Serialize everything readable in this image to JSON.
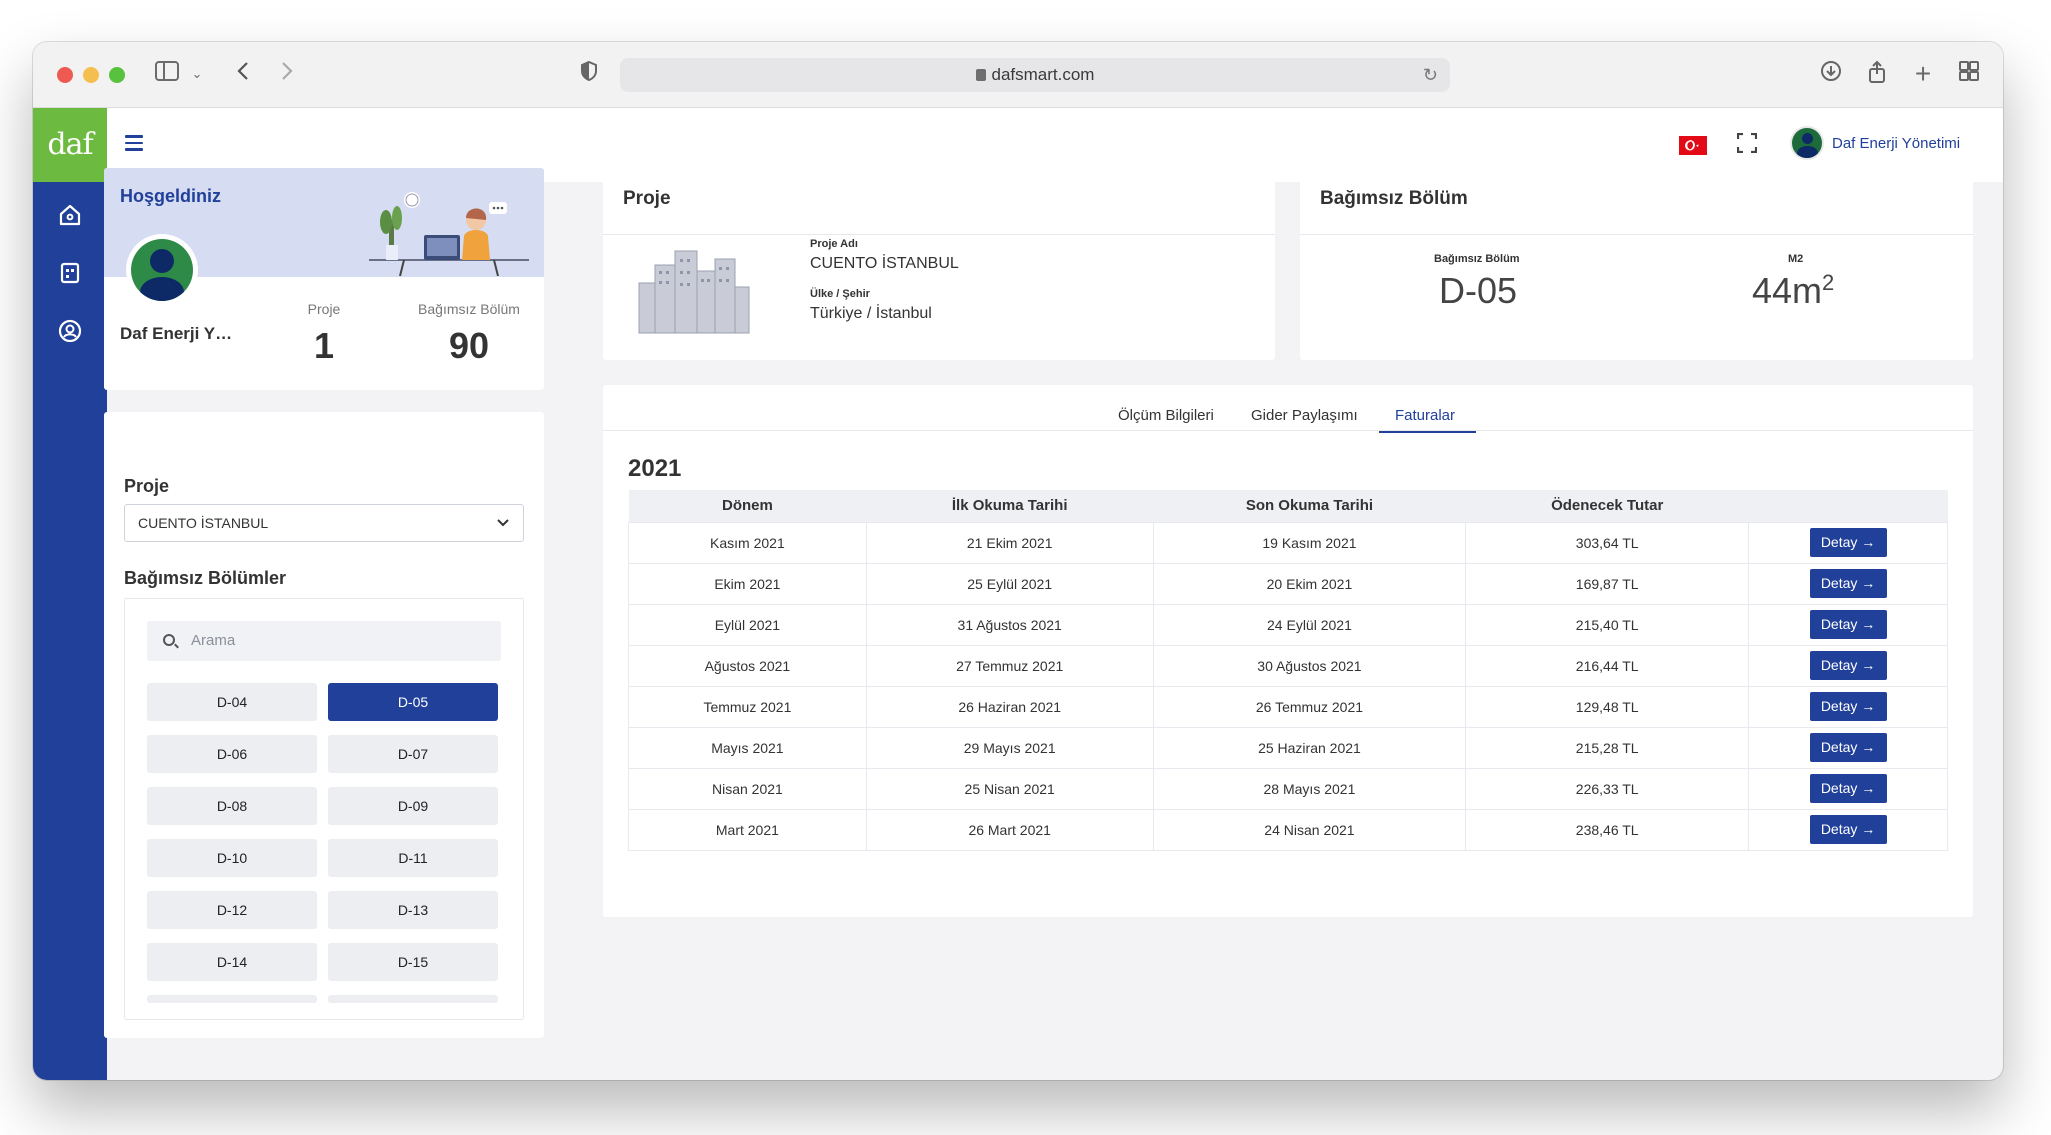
{
  "browser": {
    "url": "dafsmart.com"
  },
  "app": {
    "logo_text": "daf",
    "user_name": "Daf Enerji Yönetimi"
  },
  "welcome": {
    "title": "Hoşgeldiniz",
    "name": "Daf Enerji Yönetimi",
    "stats": [
      {
        "label": "Proje",
        "value": "1"
      },
      {
        "label": "Bağımsız Bölüm",
        "value": "90"
      }
    ]
  },
  "filter": {
    "project_label": "Proje",
    "project_selected": "CUENTO İSTANBUL",
    "units_label": "Bağımsız Bölümler",
    "search_placeholder": "Arama",
    "units": [
      "D-04",
      "D-05",
      "D-06",
      "D-07",
      "D-08",
      "D-09",
      "D-10",
      "D-11",
      "D-12",
      "D-13",
      "D-14",
      "D-15"
    ],
    "active_unit": "D-05"
  },
  "project_card": {
    "title": "Proje",
    "name_label": "Proje Adı",
    "name_value": "CUENTO İSTANBUL",
    "location_label": "Ülke / Şehir",
    "location_value": "Türkiye / İstanbul"
  },
  "unit_card": {
    "title": "Bağımsız Bölüm",
    "unit_label": "Bağımsız Bölüm",
    "unit_value": "D-05",
    "area_label": "M2",
    "area_value": "44m",
    "area_sup": "2"
  },
  "tabs": [
    {
      "label": "Ölçüm Bilgileri",
      "active": false
    },
    {
      "label": "Gider Paylaşımı",
      "active": false
    },
    {
      "label": "Faturalar",
      "active": true
    }
  ],
  "invoices": {
    "year": "2021",
    "columns": [
      "Dönem",
      "İlk Okuma Tarihi",
      "Son Okuma Tarihi",
      "Ödenecek Tutar",
      ""
    ],
    "button_label": "Detay",
    "rows": [
      [
        "Kasım 2021",
        "21 Ekim 2021",
        "19 Kasım 2021",
        "303,64 TL"
      ],
      [
        "Ekim 2021",
        "25 Eylül 2021",
        "20 Ekim 2021",
        "169,87 TL"
      ],
      [
        "Eylül 2021",
        "31 Ağustos 2021",
        "24 Eylül 2021",
        "215,40 TL"
      ],
      [
        "Ağustos 2021",
        "27 Temmuz 2021",
        "30 Ağustos 2021",
        "216,44 TL"
      ],
      [
        "Temmuz 2021",
        "26 Haziran 2021",
        "26 Temmuz 2021",
        "129,48 TL"
      ],
      [
        "Mayıs 2021",
        "29 Mayıs 2021",
        "25 Haziran 2021",
        "215,28 TL"
      ],
      [
        "Nisan 2021",
        "25 Nisan 2021",
        "28 Mayıs 2021",
        "226,33 TL"
      ],
      [
        "Mart 2021",
        "26 Mart 2021",
        "24 Nisan 2021",
        "238,46 TL"
      ]
    ]
  },
  "colors": {
    "brand_blue": "#21409a",
    "brand_green": "#6cba3f"
  }
}
